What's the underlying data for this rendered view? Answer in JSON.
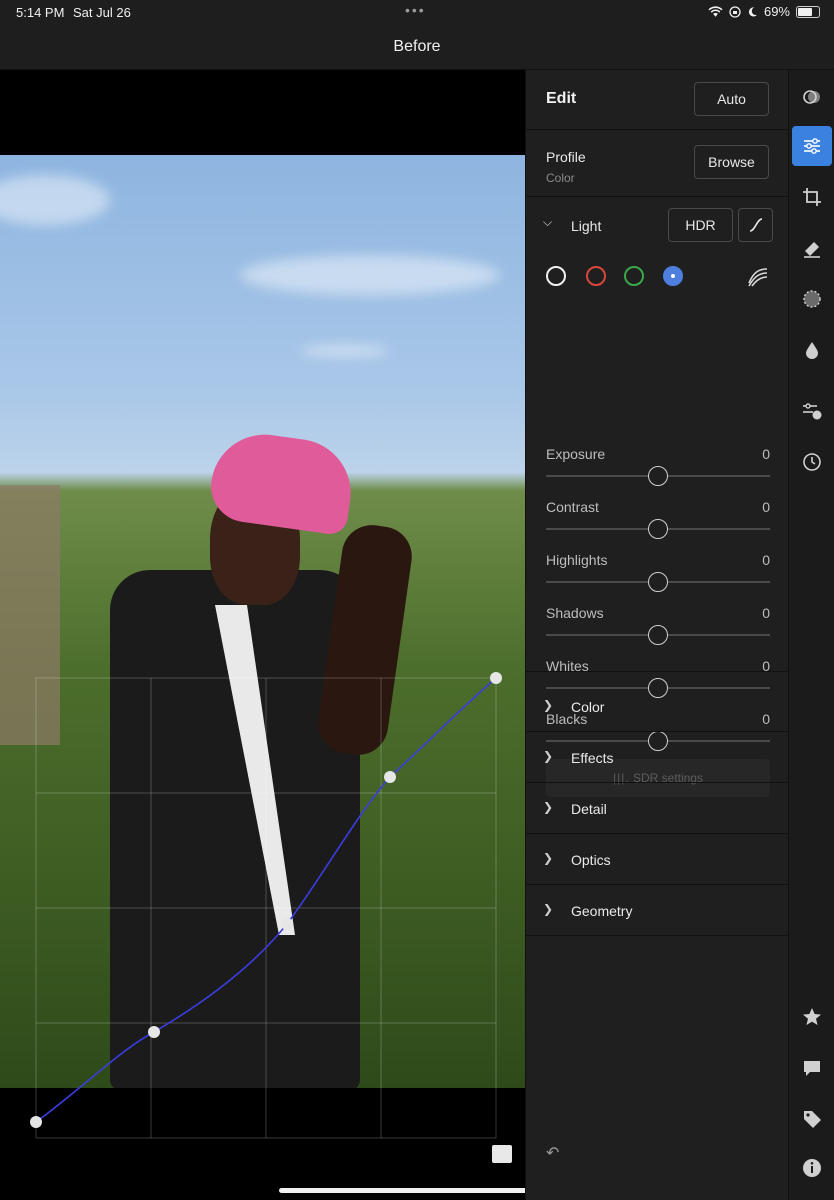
{
  "status": {
    "time": "5:14 PM",
    "date": "Sat Jul 26",
    "battery": "69%",
    "battery_level": 0.69
  },
  "title": "Before",
  "edit": {
    "title": "Edit",
    "auto_label": "Auto",
    "profile_label": "Profile",
    "profile_value": "Color",
    "browse_label": "Browse",
    "light_label": "Light",
    "hdr_label": "HDR",
    "curve_channels": [
      "white",
      "red",
      "green",
      "blue"
    ],
    "sliders": [
      {
        "name": "Exposure",
        "value": "0"
      },
      {
        "name": "Contrast",
        "value": "0"
      },
      {
        "name": "Highlights",
        "value": "0"
      },
      {
        "name": "Shadows",
        "value": "0"
      },
      {
        "name": "Whites",
        "value": "0"
      },
      {
        "name": "Blacks",
        "value": "0"
      }
    ],
    "sdr_settings_label": "SDR settings",
    "sections": [
      "Color",
      "Effects",
      "Detail",
      "Optics",
      "Geometry"
    ]
  },
  "tools": [
    "presets-icon",
    "edit-sliders-icon",
    "crop-icon",
    "healing-eraser-icon",
    "masking-icon",
    "selective-icon",
    "versions-icon",
    "history-icon",
    "star-icon",
    "comment-icon",
    "tag-icon",
    "info-icon"
  ],
  "colors": {
    "accent": "#3b82e0",
    "red_channel": "#d9463e",
    "green_channel": "#3aa84a",
    "blue_channel": "#4f7fde"
  }
}
